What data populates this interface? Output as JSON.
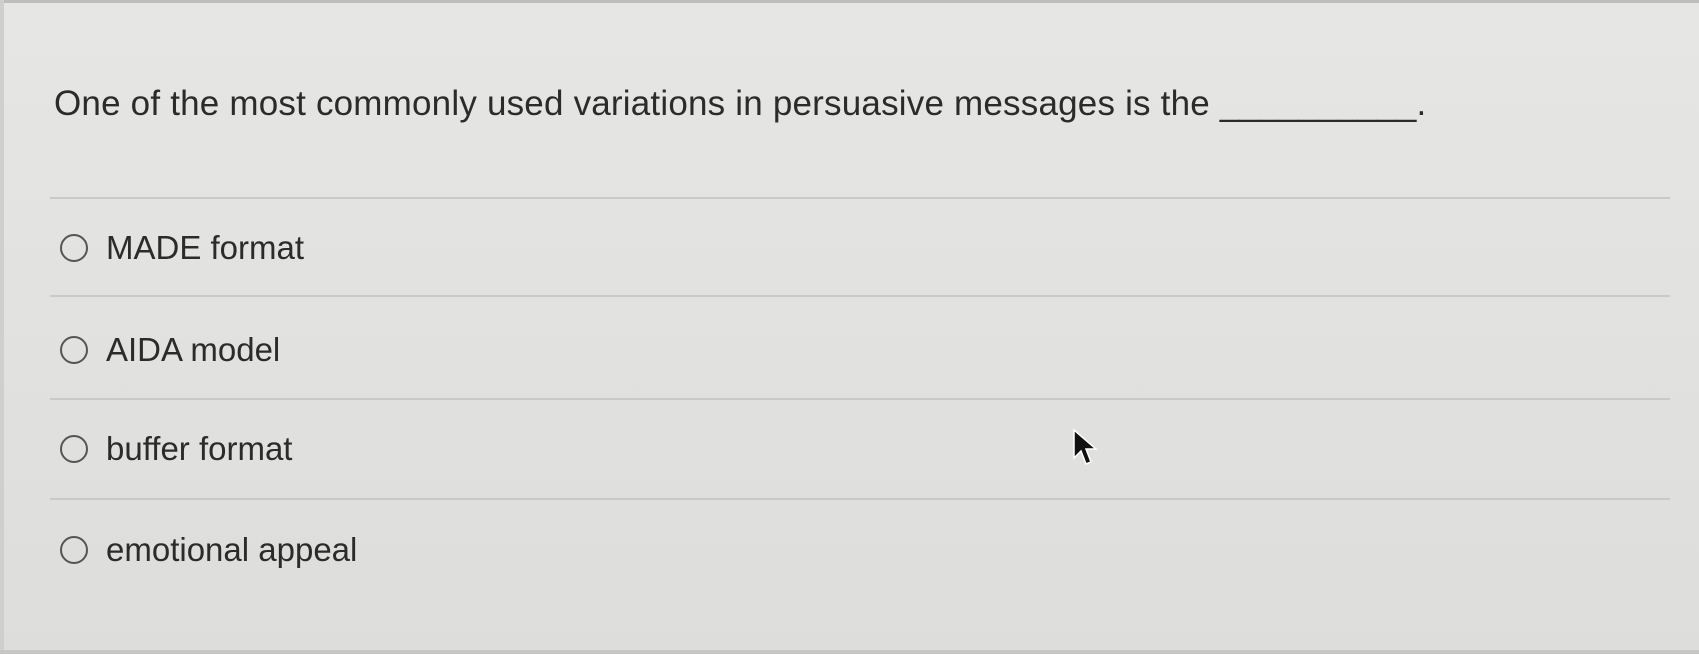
{
  "question": {
    "text": "One of the most commonly used variations in persuasive messages is the __________."
  },
  "options": [
    {
      "label": "MADE format",
      "selected": false
    },
    {
      "label": "AIDA model",
      "selected": false
    },
    {
      "label": "buffer format",
      "selected": false
    },
    {
      "label": "emotional appeal",
      "selected": false
    }
  ],
  "icons": {
    "cursor": "mouse-pointer-icon",
    "radio": "radio-button-icon"
  }
}
